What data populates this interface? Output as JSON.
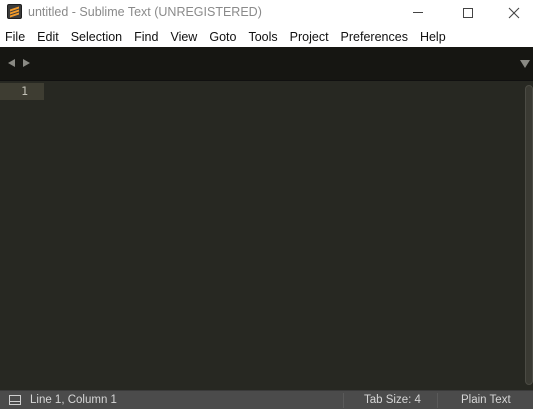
{
  "window": {
    "title": "untitled - Sublime Text (UNREGISTERED)"
  },
  "menu": {
    "items": [
      "File",
      "Edit",
      "Selection",
      "Find",
      "View",
      "Goto",
      "Tools",
      "Project",
      "Preferences",
      "Help"
    ]
  },
  "editor": {
    "line_numbers": [
      "1"
    ],
    "content": ""
  },
  "statusbar": {
    "position": "Line 1, Column 1",
    "tab_size": "Tab Size: 4",
    "syntax": "Plain Text"
  },
  "icons": {
    "app": "sublime-text-icon",
    "minimize": "minimize-icon",
    "maximize": "maximize-icon",
    "close": "close-icon",
    "tab_prev": "chevron-left-icon",
    "tab_next": "chevron-right-icon",
    "tab_list": "chevron-down-icon",
    "panel_toggle": "panel-toggle-icon"
  },
  "colors": {
    "editor_background": "#272822",
    "tabbar_background": "#161612",
    "statusbar_background": "#4b4b4b",
    "current_line": "#3e3d32"
  }
}
